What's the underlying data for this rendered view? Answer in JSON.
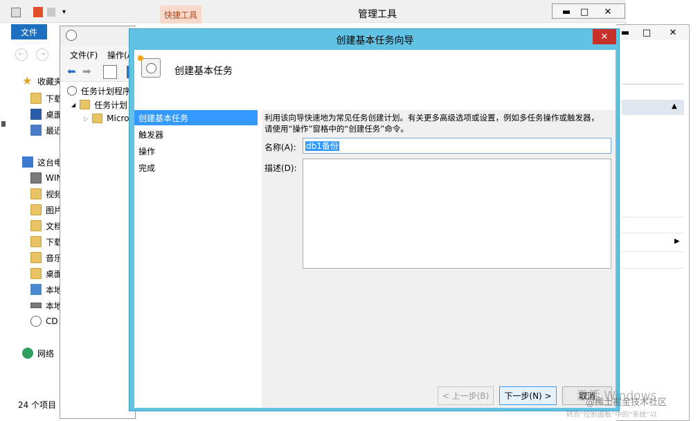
{
  "explorer": {
    "title": "管理工具",
    "quick_tab": "快捷工具",
    "file_tab": "文件",
    "status": "24 个项目",
    "nav": [
      {
        "label": "收藏夹",
        "icon": "star-icon"
      },
      {
        "label": "下载",
        "icon": "download-folder-icon"
      },
      {
        "label": "桌面",
        "icon": "desktop-icon"
      },
      {
        "label": "最近",
        "icon": "recent-icon"
      },
      {
        "label": "这台电",
        "icon": "computer-icon"
      },
      {
        "label": "WIN",
        "icon": "network-drive-icon"
      },
      {
        "label": "视频",
        "icon": "video-folder-icon"
      },
      {
        "label": "图片",
        "icon": "picture-folder-icon"
      },
      {
        "label": "文档",
        "icon": "document-folder-icon"
      },
      {
        "label": "下载",
        "icon": "download-folder-icon"
      },
      {
        "label": "音乐",
        "icon": "music-folder-icon"
      },
      {
        "label": "桌面",
        "icon": "desktop-folder-icon"
      },
      {
        "label": "本地",
        "icon": "local-disk-icon"
      },
      {
        "label": "本地",
        "icon": "local-disk-icon"
      },
      {
        "label": "CD",
        "icon": "cd-drive-icon"
      },
      {
        "label": "网络",
        "icon": "network-icon"
      }
    ]
  },
  "scheduler": {
    "menu_file": "文件(F)",
    "menu_action": "操作(A",
    "tree": [
      "任务计划程序",
      "任务计划",
      "Micro"
    ]
  },
  "wizard": {
    "title": "创建基本任务向导",
    "header": "创建基本任务",
    "steps": [
      "创建基本任务",
      "触发器",
      "操作",
      "完成"
    ],
    "active_step": 0,
    "description": "利用该向导快速地为常见任务创建计划。有关更多高级选项或设置，例如多任务操作或触发器，请使用“操作”窗格中的“创建任务”命令。",
    "name_label": "名称(A):",
    "name_value": "db1备份",
    "desc_label": "描述(D):",
    "desc_value": "",
    "back_button": "< 上一步(B)",
    "next_button": "下一步(N) >",
    "cancel_button": "取消"
  },
  "watermark": {
    "activate": "激活 Windows",
    "hint": "转到“控制面板”中的“系统”以",
    "community": "@稀土掘金技术社区"
  },
  "colors": {
    "wizard_frame": "#5fbfe0",
    "close_red": "#c7302b",
    "selection_blue": "#3399ff",
    "input_border": "#7aa6d8"
  }
}
